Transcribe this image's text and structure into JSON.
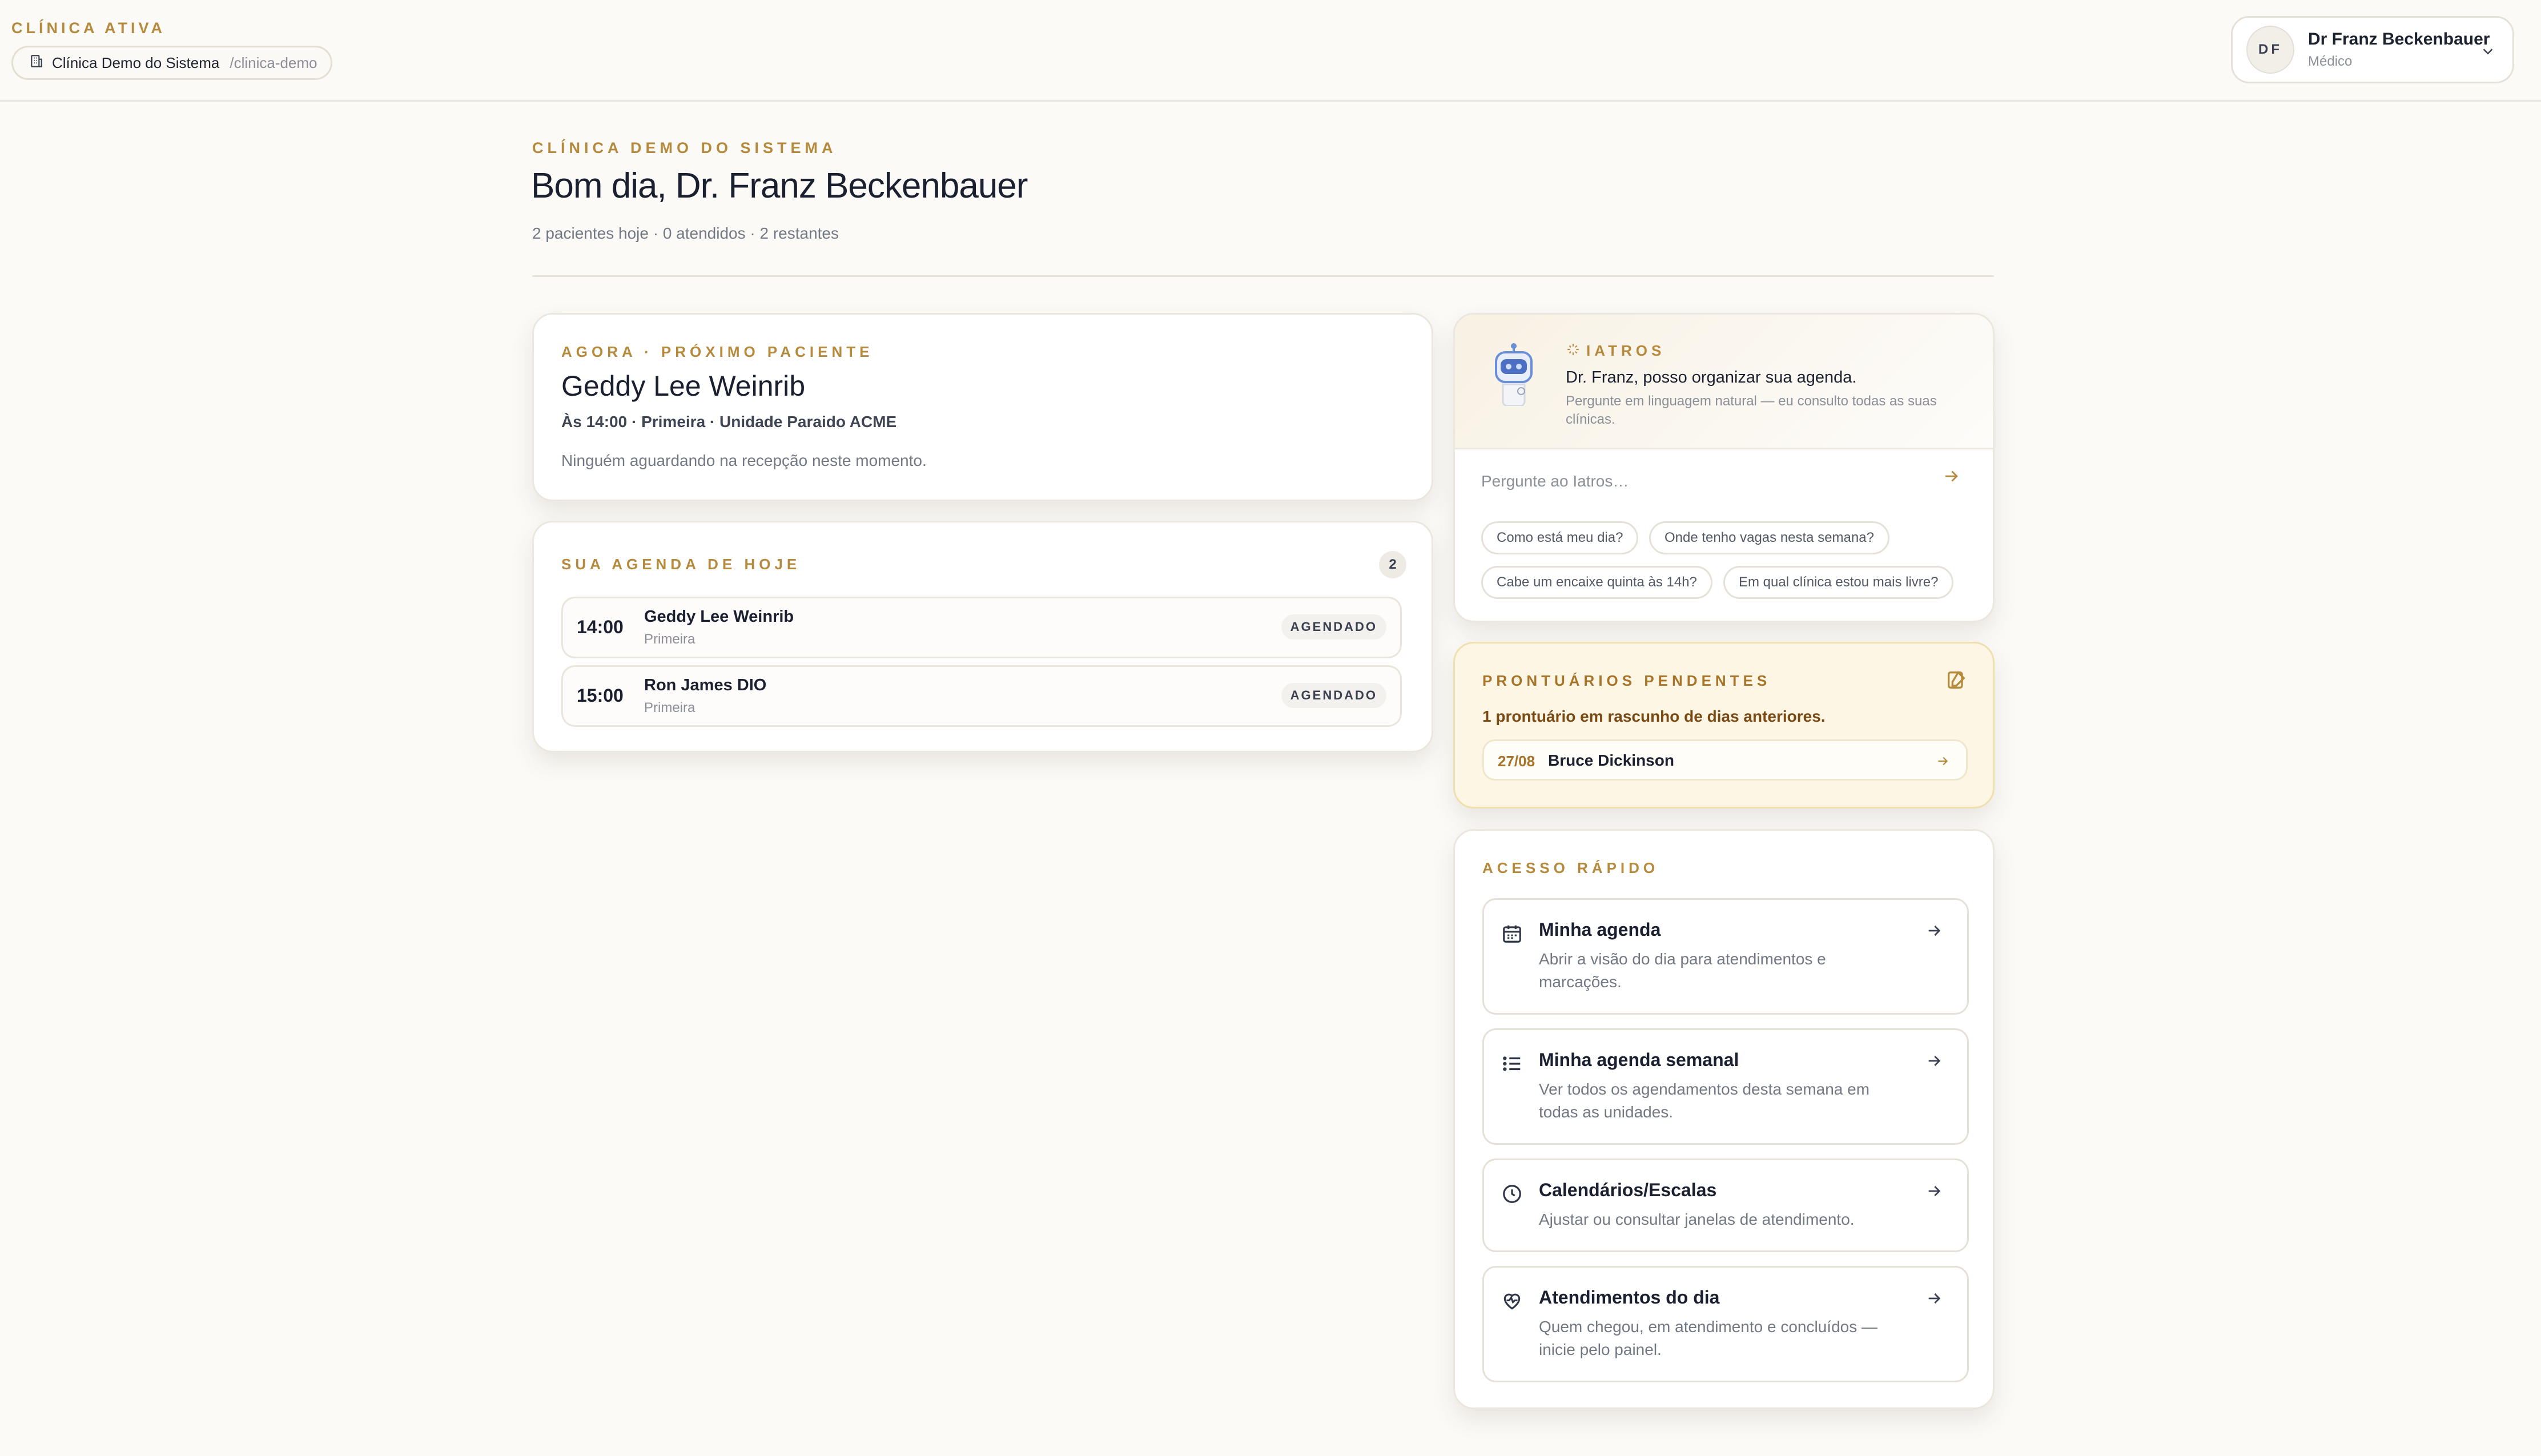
{
  "header": {
    "clinic_label": "CLÍNICA ATIVA",
    "clinic_name": "Clínica Demo do Sistema",
    "clinic_slug": "/clinica-demo",
    "user_initials": "DF",
    "user_name": "Dr Franz Beckenbauer",
    "user_role": "Médico"
  },
  "hero": {
    "kicker": "CLÍNICA DEMO DO SISTEMA",
    "greeting": "Bom dia, Dr. Franz Beckenbauer",
    "summary": "2 pacientes hoje · 0 atendidos · 2 restantes"
  },
  "next_patient": {
    "label": "AGORA · PRÓXIMO PACIENTE",
    "name": "Geddy Lee Weinrib",
    "meta": "Às 14:00 · Primeira · Unidade Paraido ACME",
    "waiting": "Ninguém aguardando na recepção neste momento."
  },
  "agenda": {
    "label": "SUA AGENDA DE HOJE",
    "count": "2",
    "items": [
      {
        "time": "14:00",
        "name": "Geddy Lee Weinrib",
        "type": "Primeira",
        "status": "AGENDADO"
      },
      {
        "time": "15:00",
        "name": "Ron James DIO",
        "type": "Primeira",
        "status": "AGENDADO"
      }
    ]
  },
  "iatros": {
    "label": "IATROS",
    "title": "Dr. Franz, posso organizar sua agenda.",
    "subtitle": "Pergunte em linguagem natural — eu consulto todas as suas clínicas.",
    "placeholder": "Pergunte ao Iatros…",
    "chips": [
      "Como está meu dia?",
      "Onde tenho vagas nesta semana?",
      "Cabe um encaixe quinta às 14h?",
      "Em qual clínica estou mais livre?"
    ]
  },
  "pending": {
    "label": "PRONTUÁRIOS PENDENTES",
    "text": "1 prontuário em rascunho de dias anteriores.",
    "items": [
      {
        "date": "27/08",
        "name": "Bruce Dickinson"
      }
    ]
  },
  "quick": {
    "label": "ACESSO RÁPIDO",
    "items": [
      {
        "title": "Minha agenda",
        "desc": "Abrir a visão do dia para atendimentos e marcações.",
        "icon": "calendar-icon"
      },
      {
        "title": "Minha agenda semanal",
        "desc": "Ver todos os agendamentos desta semana em todas as unidades.",
        "icon": "list-icon"
      },
      {
        "title": "Calendários/Escalas",
        "desc": "Ajustar ou consultar janelas de atendimento.",
        "icon": "clock-icon"
      },
      {
        "title": "Atendimentos do dia",
        "desc": "Quem chegou, em atendimento e concluídos — inicie pelo painel.",
        "icon": "heart-pulse-icon"
      }
    ]
  },
  "colors": {
    "accent": "#b68a3d",
    "background": "#fcfaf7",
    "pending_bg": "#fdf6e4",
    "text_dark": "#1a2030"
  }
}
